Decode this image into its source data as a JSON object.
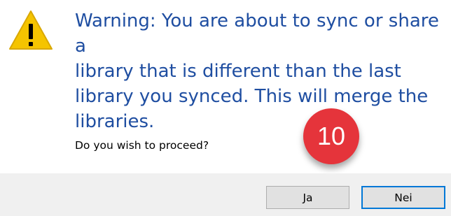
{
  "dialog": {
    "icon": "warning-icon",
    "message": "Warning: You are about to sync or share a\nlibrary that is different than the last\nlibrary you synced. This will merge the\nlibraries.",
    "question": "Do you wish to proceed?",
    "step_number": "10",
    "buttons": {
      "yes_label": "Ja",
      "no_label": "Nei"
    },
    "colors": {
      "message_text": "#1f4ea1",
      "warning_yellow": "#f5c400",
      "badge_red": "#e5343b",
      "focus_border": "#0078d7"
    }
  }
}
